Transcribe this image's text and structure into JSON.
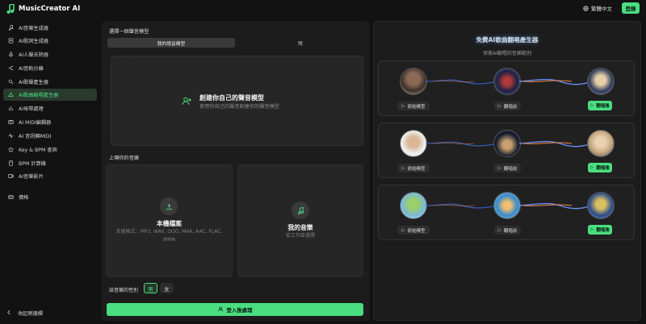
{
  "app": {
    "name": "MusicCreator AI",
    "language": "繁體中文",
    "login": "登錄"
  },
  "sidebar": {
    "items": [
      {
        "label": "AI音樂生成器",
        "icon": "music-note-icon"
      },
      {
        "label": "AI歌詞生成器",
        "icon": "lyrics-icon"
      },
      {
        "label": "AI人聲去除器",
        "icon": "vocal-remover-icon"
      },
      {
        "label": "AI音軌分離",
        "icon": "stem-split-icon"
      },
      {
        "label": "AI歌聲產生器",
        "icon": "singing-icon"
      },
      {
        "label": "AI歌曲翻唱產生器",
        "icon": "cover-icon",
        "active": true
      },
      {
        "label": "AI母帶處理",
        "icon": "mastering-icon"
      },
      {
        "label": "AI MIDI編輯器",
        "icon": "midi-icon"
      },
      {
        "label": "AI 音訊轉MIDI",
        "icon": "audio-midi-icon"
      },
      {
        "label": "Key & BPM 查詢",
        "icon": "key-bpm-icon"
      },
      {
        "label": "BPM 計算機",
        "icon": "calculator-icon"
      },
      {
        "label": "AI音樂影片",
        "icon": "video-icon"
      },
      {
        "label": "價格",
        "icon": "price-icon"
      }
    ],
    "collapse": "收起側邊欄"
  },
  "left": {
    "section_model": "選擇一個聲音模型",
    "tab_mine": "我的語音模型",
    "tab_other": "陽",
    "create_title": "創建你自己的聲音模型",
    "create_sub": "使用你自己的聲音創建你的聲音模型",
    "section_upload": "上傳你的音樂",
    "local_title": "本機檔案",
    "local_formats": "支援格式：MP3, WAV, OGG, M4A, AAC, FLAC, WMA",
    "mine_title": "我的音樂",
    "mine_sub": "從工作區選擇",
    "gender_label": "該音樂的性別",
    "gender_male": "男",
    "gender_female": "女",
    "process": "登入後處理"
  },
  "right": {
    "title": "免費AI歌曲翻唱產生器",
    "subtitle": "探索AI翻唱的音樂範例",
    "btn_original": "原始模型",
    "btn_before": "翻唱前",
    "btn_after": "翻唱後"
  },
  "colors": {
    "accent": "#4ade80",
    "bg": "#121212",
    "panel": "#1c1c1c"
  }
}
